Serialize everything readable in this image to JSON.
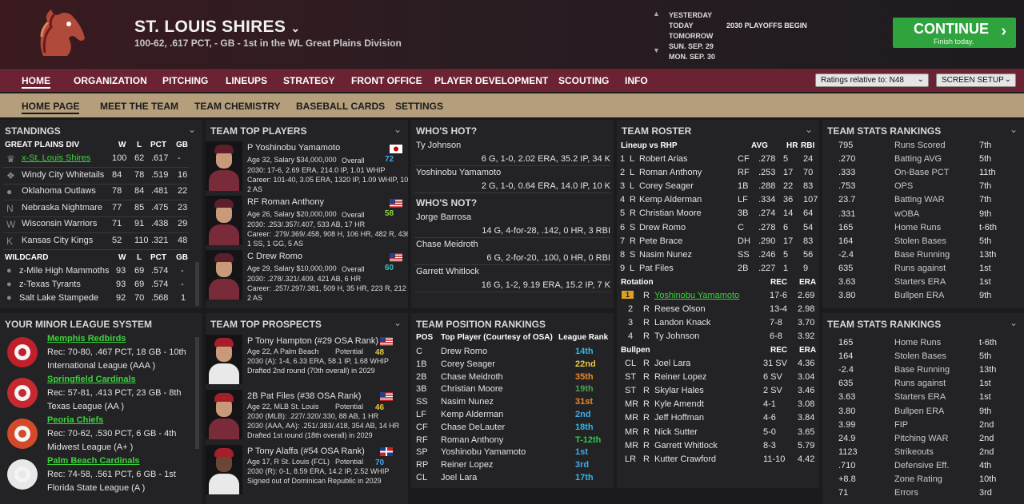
{
  "header": {
    "team": "ST. LOUIS SHIRES",
    "record": "100-62, .617 PCT, - GB - 1st in the WL Great Plains Division",
    "dates": [
      "YESTERDAY",
      "TODAY",
      "TOMORROW",
      "SUN. SEP. 29",
      "MON. SEP. 30"
    ],
    "event": "2030 PLAYOFFS BEGIN",
    "continue": "CONTINUE",
    "continue_sub": "Finish today."
  },
  "nav": {
    "items": [
      "HOME",
      "ORGANIZATION",
      "PITCHING",
      "LINEUPS",
      "STRATEGY",
      "FRONT OFFICE",
      "PLAYER DEVELOPMENT",
      "SCOUTING",
      "INFO"
    ],
    "ratings_select": "Ratings relative to: N48",
    "screen_setup": "SCREEN SETUP"
  },
  "subnav": [
    "HOME PAGE",
    "MEET THE TEAM",
    "TEAM CHEMISTRY",
    "BASEBALL CARDS",
    "SETTINGS"
  ],
  "standings": {
    "title": "STANDINGS",
    "div": "GREAT PLAINS DIV",
    "wildcard": "WILDCARD",
    "cols": [
      "W",
      "L",
      "PCT",
      "GB"
    ],
    "rows": [
      [
        "x-St. Louis Shires",
        "100",
        "62",
        ".617",
        "-"
      ],
      [
        "Windy City Whitetails",
        "84",
        "78",
        ".519",
        "16"
      ],
      [
        "Oklahoma Outlaws",
        "78",
        "84",
        ".481",
        "22"
      ],
      [
        "Nebraska Nightmare",
        "77",
        "85",
        ".475",
        "23"
      ],
      [
        "Wisconsin Warriors",
        "71",
        "91",
        ".438",
        "29"
      ],
      [
        "Kansas City Kings",
        "52",
        "110",
        ".321",
        "48"
      ]
    ],
    "wc": [
      [
        "z-Mile High Mammoths",
        "93",
        "69",
        ".574",
        "-"
      ],
      [
        "z-Texas Tyrants",
        "93",
        "69",
        ".574",
        "-"
      ],
      [
        "Salt Lake Stampede",
        "92",
        "70",
        ".568",
        "1"
      ]
    ]
  },
  "top_players": {
    "title": "TEAM TOP PLAYERS",
    "players": [
      {
        "name": "P Yoshinobu Yamamoto",
        "info": "Age 32, Salary $34,000,000",
        "ovl": "Overall",
        "val": "72",
        "l1": "2030: 17-6, 2.69 ERA, 214.0 IP, 1.01 WHIP",
        "l2": "Career: 101-40, 3.05 ERA, 1320 IP, 1.09 WHIP, 1078",
        "l3": "2 AS"
      },
      {
        "name": "RF Roman Anthony",
        "info": "Age 26, Salary $20,000,000",
        "ovl": "Overall",
        "val": "58",
        "l1": "2030: .253/.357/.407, 533 AB, 17 HR",
        "l2": "Career: .279/.369/.458, 908 H, 106 HR, 482 R, 436 R",
        "l3": "1 SS, 1 GG, 5 AS"
      },
      {
        "name": "C Drew Romo",
        "info": "Age 29, Salary $10,000,000",
        "ovl": "Overall",
        "val": "60",
        "l1": "2030: .278/.321/.409, 421 AB, 6 HR",
        "l2": "Career: .257/.297/.381, 509 H, 35 HR, 223 R, 212 RB",
        "l3": "2 AS"
      }
    ]
  },
  "hot": {
    "title": "WHO'S HOT?",
    "rows": [
      [
        "Ty Johnson",
        "6 G, 1-0, 2.02 ERA, 35.2 IP, 34 K"
      ],
      [
        "Yoshinobu Yamamoto",
        "2 G, 1-0, 0.64 ERA, 14.0 IP, 10 K"
      ]
    ],
    "not_title": "WHO'S NOT?",
    "not_rows": [
      [
        "Jorge Barrosa",
        "14 G, 4-for-28, .142, 0 HR, 3 RBI"
      ],
      [
        "Chase Meidroth",
        "6 G, 2-for-20, .100, 0 HR, 0 RBI"
      ],
      [
        "Garrett Whitlock",
        "16 G, 1-2, 9.19 ERA, 15.2 IP, 7 K"
      ]
    ]
  },
  "roster": {
    "title": "TEAM ROSTER",
    "lineup_hdr": [
      "Lineup vs RHP",
      "AVG",
      "HR",
      "RBI"
    ],
    "lineup": [
      [
        "1",
        "L",
        "Robert Arias",
        "CF",
        ".278",
        "5",
        "24"
      ],
      [
        "2",
        "L",
        "Roman Anthony",
        "RF",
        ".253",
        "17",
        "70"
      ],
      [
        "3",
        "L",
        "Corey Seager",
        "1B",
        ".288",
        "22",
        "83"
      ],
      [
        "4",
        "R",
        "Kemp Alderman",
        "LF",
        ".334",
        "36",
        "107"
      ],
      [
        "5",
        "R",
        "Christian Moore",
        "3B",
        ".274",
        "14",
        "64"
      ],
      [
        "6",
        "S",
        "Drew Romo",
        "C",
        ".278",
        "6",
        "54"
      ],
      [
        "7",
        "R",
        "Pete Brace",
        "DH",
        ".290",
        "17",
        "83"
      ],
      [
        "8",
        "S",
        "Nasim Nunez",
        "SS",
        ".246",
        "5",
        "56"
      ],
      [
        "9",
        "L",
        "Pat Files",
        "2B",
        ".227",
        "1",
        "9"
      ]
    ],
    "rot_hdr": [
      "Rotation",
      "REC",
      "ERA"
    ],
    "rot": [
      [
        "1",
        "R",
        "Yoshinobu Yamamoto",
        "17-6",
        "2.69"
      ],
      [
        "2",
        "R",
        "Reese Olson",
        "13-4",
        "2.98"
      ],
      [
        "3",
        "R",
        "Landon Knack",
        "7-8",
        "3.70"
      ],
      [
        "4",
        "R",
        "Ty Johnson",
        "6-8",
        "3.92"
      ]
    ],
    "pen_hdr": [
      "Bullpen",
      "REC",
      "ERA"
    ],
    "pen": [
      [
        "CL",
        "R",
        "Joel Lara",
        "31 SV",
        "4.36"
      ],
      [
        "ST",
        "R",
        "Reiner Lopez",
        "6 SV",
        "3.04"
      ],
      [
        "ST",
        "R",
        "Skylar Hales",
        "2 SV",
        "3.46"
      ],
      [
        "MR",
        "R",
        "Kyle Amendt",
        "4-1",
        "3.08"
      ],
      [
        "MR",
        "R",
        "Jeff Hoffman",
        "4-6",
        "3.84"
      ],
      [
        "MR",
        "R",
        "Nick Sutter",
        "5-0",
        "3.65"
      ],
      [
        "MR",
        "R",
        "Garrett Whitlock",
        "8-3",
        "5.79"
      ],
      [
        "LR",
        "R",
        "Kutter Crawford",
        "11-10",
        "4.42"
      ]
    ]
  },
  "stats1": {
    "title": "TEAM STATS RANKINGS",
    "rows": [
      [
        "795",
        "Runs Scored",
        "7th"
      ],
      [
        ".270",
        "Batting AVG",
        "5th"
      ],
      [
        ".333",
        "On-Base PCT",
        "11th"
      ],
      [
        ".753",
        "OPS",
        "7th"
      ],
      [
        "23.7",
        "Batting WAR",
        "7th"
      ],
      [
        ".331",
        "wOBA",
        "9th"
      ],
      [
        "165",
        "Home Runs",
        "t-6th"
      ],
      [
        "164",
        "Stolen Bases",
        "5th"
      ],
      [
        "-2.4",
        "Base Running",
        "13th"
      ],
      [
        "635",
        "Runs against",
        "1st"
      ],
      [
        "3.63",
        "Starters ERA",
        "1st"
      ],
      [
        "3.80",
        "Bullpen ERA",
        "9th"
      ]
    ]
  },
  "stats2": {
    "title": "TEAM STATS RANKINGS",
    "rows": [
      [
        "165",
        "Home Runs",
        "t-6th"
      ],
      [
        "164",
        "Stolen Bases",
        "5th"
      ],
      [
        "-2.4",
        "Base Running",
        "13th"
      ],
      [
        "635",
        "Runs against",
        "1st"
      ],
      [
        "3.63",
        "Starters ERA",
        "1st"
      ],
      [
        "3.80",
        "Bullpen ERA",
        "9th"
      ],
      [
        "3.99",
        "FIP",
        "2nd"
      ],
      [
        "24.9",
        "Pitching WAR",
        "2nd"
      ],
      [
        "1123",
        "Strikeouts",
        "2nd"
      ],
      [
        ".710",
        "Defensive Eff.",
        "4th"
      ],
      [
        "+8.8",
        "Zone Rating",
        "10th"
      ],
      [
        "71",
        "Errors",
        "3rd"
      ]
    ]
  },
  "minors": {
    "title": "YOUR MINOR LEAGUE SYSTEM",
    "teams": [
      {
        "name": "Memphis Redbirds",
        "rec": "Rec: 70-80, .467 PCT, 18 GB - 10th",
        "lg": "International League (AAA )"
      },
      {
        "name": "Springfield Cardinals",
        "rec": "Rec: 57-81, .413 PCT, 23 GB - 8th",
        "lg": "Texas League (AA )"
      },
      {
        "name": "Peoria Chiefs",
        "rec": "Rec: 70-62, .530 PCT, 6 GB - 4th",
        "lg": "Midwest League (A+ )"
      },
      {
        "name": "Palm Beach Cardinals",
        "rec": "Rec: 74-58, .561 PCT, 6 GB - 1st",
        "lg": "Florida State League (A )"
      }
    ]
  },
  "prospects": {
    "title": "TEAM TOP PROSPECTS",
    "players": [
      {
        "name": "P Tony Hampton (#29 OSA Rank)",
        "info": "Age 22, A Palm Beach",
        "pot": "Potential",
        "val": "48",
        "l1": "2030 (A): 1-4, 6.33 ERA, 58.1 IP, 1.68 WHIP",
        "l2": "Drafted 2nd round (70th overall) in 2029"
      },
      {
        "name": "2B Pat Files (#38 OSA Rank)",
        "info": "Age 22, MLB St. Louis",
        "pot": "Potential",
        "val": "46",
        "l1": "2030 (MLB): .227/.320/.330, 88 AB, 1 HR",
        "l2": "2030 (AAA, AA): .251/.383/.418, 354 AB, 14 HR",
        "l3": "Drafted 1st round (18th overall) in 2029"
      },
      {
        "name": "P Tony Alaffa (#54 OSA Rank)",
        "info": "Age 17, R St. Louis (FCL)",
        "pot": "Potential",
        "val": "70",
        "l1": "2030 (R): 0-1, 8.59 ERA, 14.2 IP, 2.52 WHIP",
        "l2": "Signed out of Dominican Republic in 2029"
      }
    ]
  },
  "positions": {
    "title": "TEAM POSITION RANKINGS",
    "cols": [
      "POS",
      "Top Player (Courtesy of OSA)",
      "League Rank"
    ],
    "rows": [
      [
        "C",
        "Drew Romo",
        "14th"
      ],
      [
        "1B",
        "Corey Seager",
        "22nd"
      ],
      [
        "2B",
        "Chase Meidroth",
        "35th"
      ],
      [
        "3B",
        "Christian Moore",
        "19th"
      ],
      [
        "SS",
        "Nasim Nunez",
        "31st"
      ],
      [
        "LF",
        "Kemp Alderman",
        "2nd"
      ],
      [
        "CF",
        "Chase DeLauter",
        "18th"
      ],
      [
        "RF",
        "Roman Anthony",
        "T-12th"
      ],
      [
        "SP",
        "Yoshinobu Yamamoto",
        "1st"
      ],
      [
        "RP",
        "Reiner Lopez",
        "3rd"
      ],
      [
        "CL",
        "Joel Lara",
        "17th"
      ]
    ]
  }
}
